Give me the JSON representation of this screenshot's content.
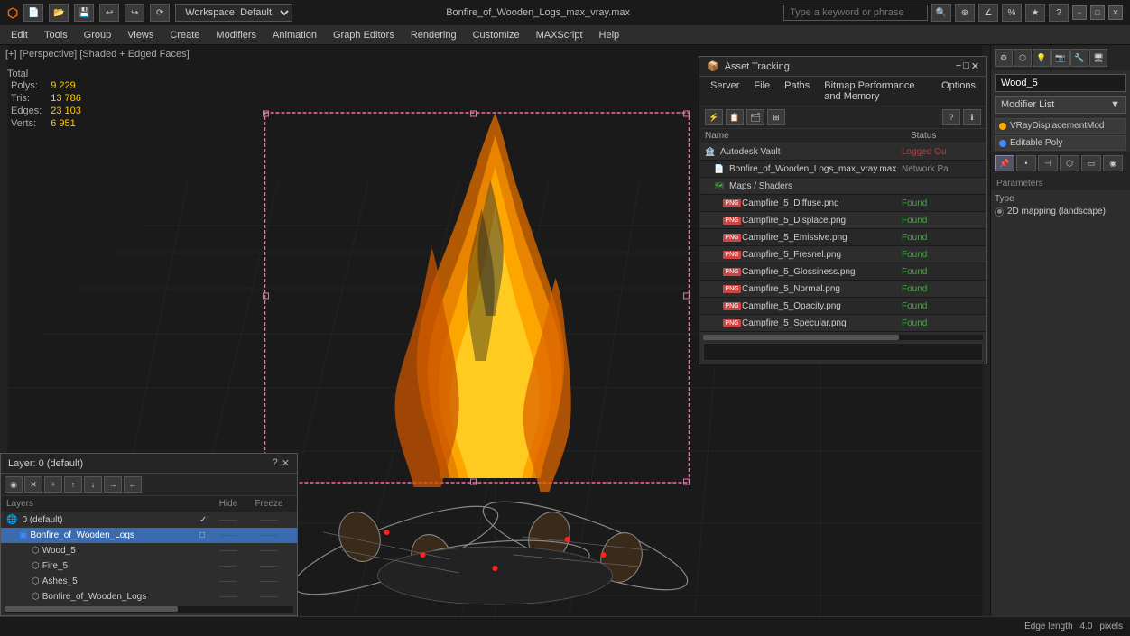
{
  "titlebar": {
    "title": "Bonfire_of_Wooden_Logs_max_vray.max",
    "workspace": "Workspace: Default",
    "search_placeholder": "Type a keyword or phrase",
    "minimize": "−",
    "maximize": "□",
    "close": "✕"
  },
  "menubar": {
    "items": [
      "Edit",
      "Tools",
      "Group",
      "Views",
      "Create",
      "Modifiers",
      "Animation",
      "Graph Editors",
      "Rendering",
      "Customize",
      "MAXScript",
      "Help"
    ]
  },
  "viewport_label": "[+] [Perspective] [Shaded + Edged Faces]",
  "stats": {
    "header": "Total",
    "polys_label": "Polys:",
    "polys_value": "9 229",
    "tris_label": "Tris:",
    "tris_value": "13 786",
    "edges_label": "Edges:",
    "edges_value": "23 103",
    "verts_label": "Verts:",
    "verts_value": "6 951"
  },
  "right_panel": {
    "object_name": "Wood_5",
    "modifier_list": "Modifier List",
    "modifiers": [
      {
        "name": "VRayDisplacementMod",
        "color": "orange"
      },
      {
        "name": "Editable Poly",
        "color": "blue"
      }
    ],
    "parameters_label": "Parameters",
    "type_label": "Type",
    "mapping_option": "2D mapping (landscape)"
  },
  "layer_panel": {
    "title": "Layer: 0 (default)",
    "icons": [
      "↺",
      "✕",
      "+",
      "⬆",
      "⬇",
      "→",
      "←"
    ],
    "columns": {
      "name": "Layers",
      "hide": "Hide",
      "freeze": "Freeze"
    },
    "rows": [
      {
        "name": "0 (default)",
        "indent": 0,
        "checked": true,
        "selected": false,
        "icon": "world"
      },
      {
        "name": "Bonfire_of_Wooden_Logs",
        "indent": 1,
        "selected": true,
        "icon": "box"
      },
      {
        "name": "Wood_5",
        "indent": 2,
        "selected": false,
        "icon": "mesh"
      },
      {
        "name": "Fire_5",
        "indent": 2,
        "selected": false,
        "icon": "mesh"
      },
      {
        "name": "Ashes_5",
        "indent": 2,
        "selected": false,
        "icon": "mesh"
      },
      {
        "name": "Bonfire_of_Wooden_Logs",
        "indent": 2,
        "selected": false,
        "icon": "mesh"
      }
    ]
  },
  "asset_panel": {
    "title": "Asset Tracking",
    "menus": [
      "Server",
      "File",
      "Paths",
      "Bitmap Performance and Memory",
      "Options"
    ],
    "columns": {
      "name": "Name",
      "status": "Status"
    },
    "rows": [
      {
        "indent": 0,
        "icon": "vault",
        "name": "Autodesk Vault",
        "status": "Logged Ou",
        "status_color": "#aa4444"
      },
      {
        "indent": 0,
        "icon": "file",
        "name": "Bonfire_of_Wooden_Logs_max_vray.max",
        "status": "Network Pa",
        "status_color": "#888"
      },
      {
        "indent": 1,
        "icon": "maps",
        "name": "Maps / Shaders",
        "status": "",
        "status_color": ""
      },
      {
        "indent": 2,
        "icon": "png",
        "name": "Campfire_5_Diffuse.png",
        "status": "Found",
        "status_color": "#44aa44"
      },
      {
        "indent": 2,
        "icon": "png",
        "name": "Campfire_5_Displace.png",
        "status": "Found",
        "status_color": "#44aa44"
      },
      {
        "indent": 2,
        "icon": "png",
        "name": "Campfire_5_Emissive.png",
        "status": "Found",
        "status_color": "#44aa44"
      },
      {
        "indent": 2,
        "icon": "png",
        "name": "Campfire_5_Fresnel.png",
        "status": "Found",
        "status_color": "#44aa44"
      },
      {
        "indent": 2,
        "icon": "png",
        "name": "Campfire_5_Glossiness.png",
        "status": "Found",
        "status_color": "#44aa44"
      },
      {
        "indent": 2,
        "icon": "png",
        "name": "Campfire_5_Normal.png",
        "status": "Found",
        "status_color": "#44aa44"
      },
      {
        "indent": 2,
        "icon": "png",
        "name": "Campfire_5_Opacity.png",
        "status": "Found",
        "status_color": "#44aa44"
      },
      {
        "indent": 2,
        "icon": "png",
        "name": "Campfire_5_Specular.png",
        "status": "Found",
        "status_color": "#44aa44"
      }
    ]
  },
  "statusbar": {
    "edge_length_label": "Edge length",
    "edge_length_value": "4.0",
    "pixels_label": "pixels"
  }
}
